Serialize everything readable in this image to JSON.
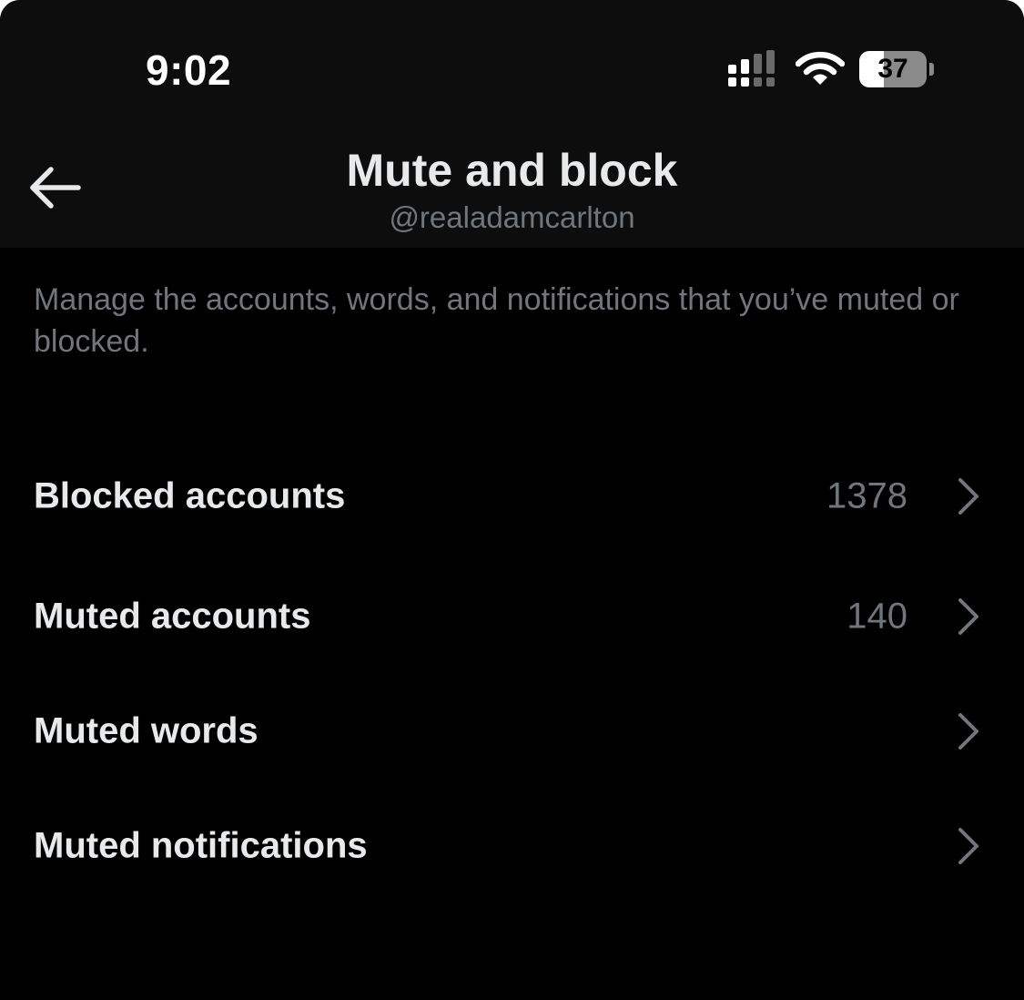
{
  "status_bar": {
    "time": "9:02",
    "battery_percent": "37",
    "battery_level": 0.37,
    "signal_icon": "cellular-signal-icon",
    "wifi_icon": "wifi-icon",
    "battery_icon": "battery-icon"
  },
  "header": {
    "back_icon": "arrow-left-icon",
    "title": "Mute and block",
    "subtitle": "@realadamcarlton"
  },
  "description": "Manage the accounts, words, and notifications that you’ve muted or blocked.",
  "menu": {
    "items": [
      {
        "label": "Blocked accounts",
        "count": "1378",
        "icon": "chevron-right-icon"
      },
      {
        "label": "Muted accounts",
        "count": "140",
        "icon": "chevron-right-icon"
      },
      {
        "label": "Muted words",
        "count": "",
        "icon": "chevron-right-icon"
      },
      {
        "label": "Muted notifications",
        "count": "",
        "icon": "chevron-right-icon"
      }
    ]
  },
  "colors": {
    "background": "#000000",
    "header_background": "#0d0d0d",
    "primary_text": "#e7e9ea",
    "secondary_text": "#71767b"
  }
}
